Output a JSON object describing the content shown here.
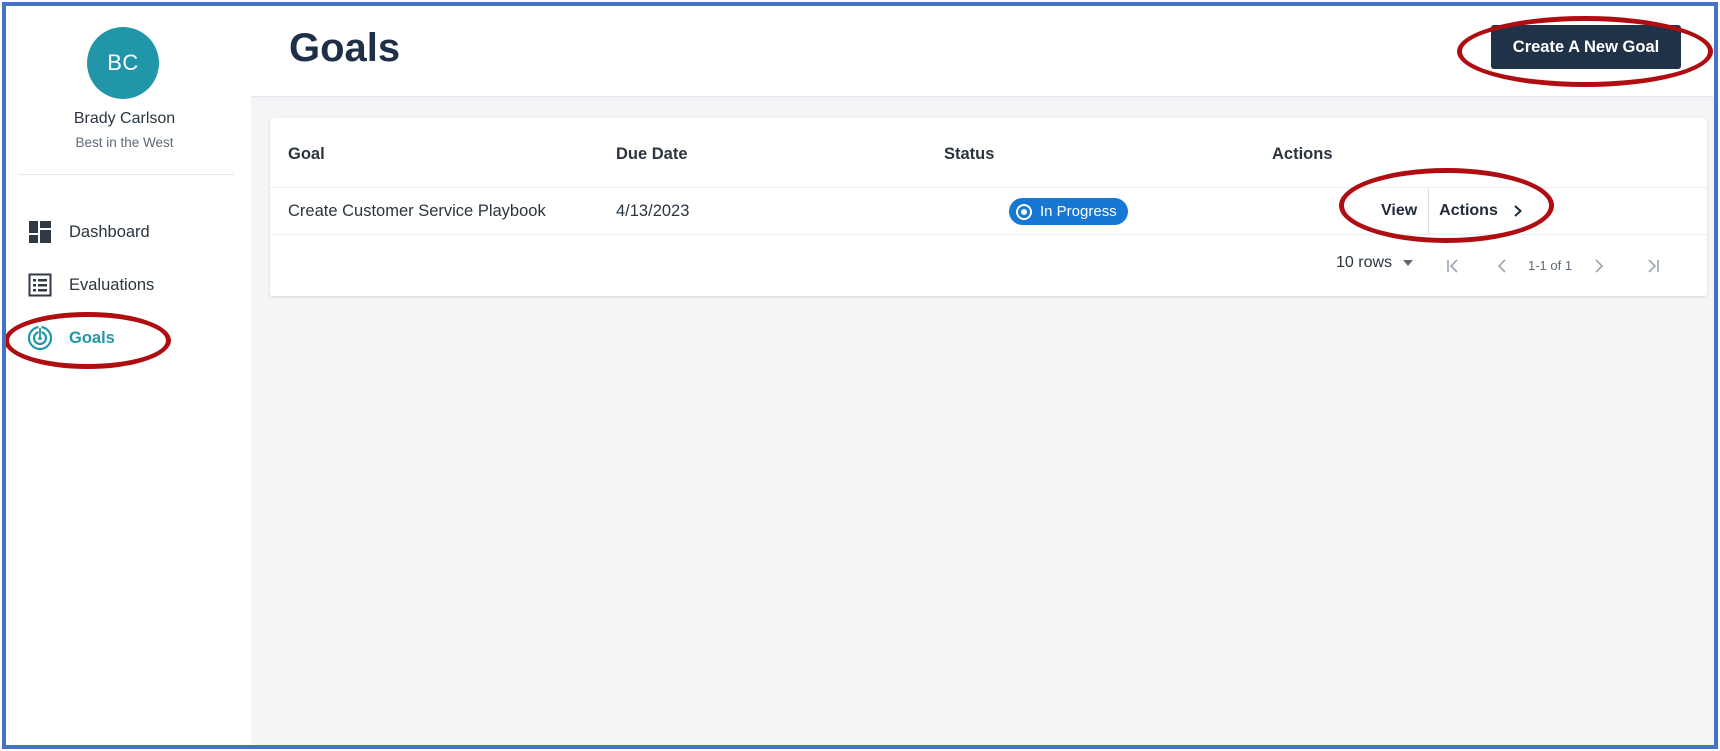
{
  "user": {
    "initials": "BC",
    "name": "Brady Carlson",
    "subtitle": "Best in the West"
  },
  "sidebar": {
    "items": [
      {
        "label": "Dashboard",
        "icon": "dashboard-icon",
        "active": false
      },
      {
        "label": "Evaluations",
        "icon": "list-icon",
        "active": false
      },
      {
        "label": "Goals",
        "icon": "target-icon",
        "active": true
      }
    ]
  },
  "header": {
    "title": "Goals",
    "create_button": "Create A New Goal"
  },
  "table": {
    "columns": [
      "Goal",
      "Due Date",
      "Status",
      "Actions"
    ],
    "rows": [
      {
        "goal": "Create Customer Service Playbook",
        "due_date": "4/13/2023",
        "status": "In Progress",
        "view_label": "View",
        "actions_label": "Actions"
      }
    ]
  },
  "pagination": {
    "rows_label": "10 rows",
    "range": "1-1 of 1"
  },
  "colors": {
    "accent": "#2196a8",
    "primary_button": "#1f3248",
    "status_in_progress": "#1778d4",
    "annotation": "#b00d12",
    "frame_border": "#4472c4"
  }
}
